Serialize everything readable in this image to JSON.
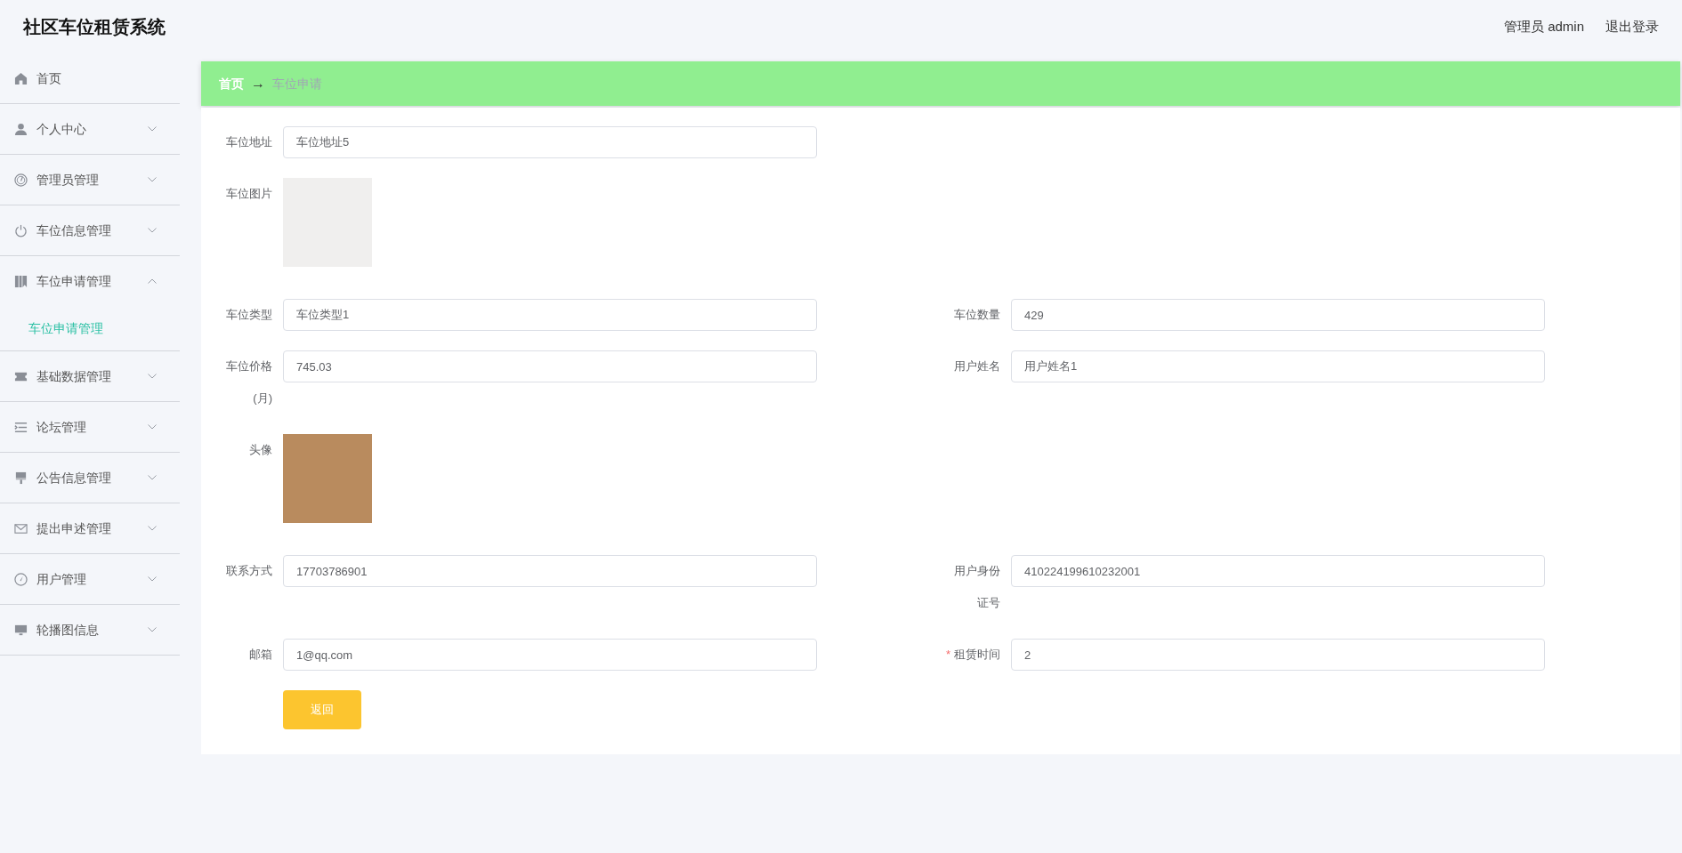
{
  "header": {
    "title": "社区车位租赁系统",
    "user": "管理员 admin",
    "logout": "退出登录"
  },
  "sidebar": {
    "items": [
      {
        "label": "首页",
        "kind": "link"
      },
      {
        "label": "个人中心",
        "kind": "submenu",
        "expanded": false
      },
      {
        "label": "管理员管理",
        "kind": "submenu",
        "expanded": false
      },
      {
        "label": "车位信息管理",
        "kind": "submenu",
        "expanded": false
      },
      {
        "label": "车位申请管理",
        "kind": "submenu",
        "expanded": true,
        "children": [
          {
            "label": "车位申请管理",
            "selected": true
          }
        ]
      },
      {
        "label": "基础数据管理",
        "kind": "submenu",
        "expanded": false
      },
      {
        "label": "论坛管理",
        "kind": "submenu",
        "expanded": false
      },
      {
        "label": "公告信息管理",
        "kind": "submenu",
        "expanded": false
      },
      {
        "label": "提出申述管理",
        "kind": "submenu",
        "expanded": false
      },
      {
        "label": "用户管理",
        "kind": "submenu",
        "expanded": false
      },
      {
        "label": "轮播图信息",
        "kind": "submenu",
        "expanded": false
      }
    ]
  },
  "breadcrumb": {
    "items": [
      "首页",
      "车位申请"
    ],
    "separator": "→"
  },
  "form": {
    "fields": [
      {
        "label": "车位地址",
        "kind": "wide_text",
        "value": "车位地址5"
      },
      {
        "label": "车位图片",
        "kind": "picture"
      },
      {
        "label": "车位类型",
        "kind": "text",
        "value": "车位类型1"
      },
      {
        "label": "车位数量",
        "kind": "text",
        "value": "429"
      },
      {
        "label": "车位价格(月)",
        "kind": "text",
        "value": "745.03"
      },
      {
        "label": "用户姓名",
        "kind": "text",
        "value": "用户姓名1"
      },
      {
        "label": "头像",
        "kind": "photo"
      },
      {
        "label": "联系方式",
        "kind": "text",
        "value": "17703786901"
      },
      {
        "label": "用户身份证号",
        "kind": "text",
        "value": "410224199610232001"
      },
      {
        "label": "邮箱",
        "kind": "text",
        "value": "1@qq.com"
      },
      {
        "label": "租赁时间",
        "kind": "text",
        "value": "2",
        "required": true,
        "required_mark": "*"
      }
    ],
    "back_button": "返回"
  }
}
